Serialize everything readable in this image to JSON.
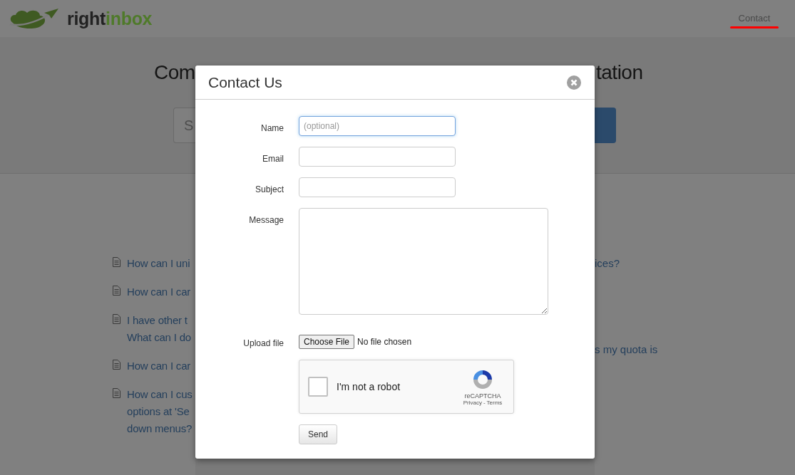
{
  "header": {
    "logo": {
      "dark": "right",
      "green": "inbox"
    },
    "nav": [
      {
        "label": "Contact",
        "marked": true
      }
    ]
  },
  "hero": {
    "title_left": "Com",
    "title_right": "tation",
    "search": {
      "placeholder": "S"
    }
  },
  "articles_left": [
    {
      "lines": [
        "How can I uni"
      ]
    },
    {
      "lines": [
        "How can I car"
      ]
    },
    {
      "lines": [
        "I have other t",
        "What can I do"
      ]
    },
    {
      "lines": [
        "How can I car"
      ]
    },
    {
      "lines": [
        "How can I cus",
        "options at 'Se",
        "down menus?"
      ]
    }
  ],
  "articles_right": [
    {
      "text": "ices?"
    },
    {
      "text": "s my quota is"
    }
  ],
  "modal": {
    "title": "Contact Us",
    "fields": [
      {
        "kind": "text",
        "label": "Name",
        "placeholder": "(optional)",
        "focused": true
      },
      {
        "kind": "text",
        "label": "Email",
        "focused": false
      },
      {
        "kind": "text",
        "label": "Subject",
        "focused": false
      },
      {
        "kind": "textarea",
        "label": "Message",
        "focused": false
      },
      {
        "kind": "file",
        "label": "Upload file",
        "button": "Choose File",
        "status": "No file chosen"
      },
      {
        "kind": "captcha",
        "text": "I'm not a robot",
        "checked": false,
        "brand": "reCAPTCHA",
        "privacy": "Privacy",
        "terms": "Terms",
        "separator": "-"
      }
    ],
    "submit": "Send"
  }
}
